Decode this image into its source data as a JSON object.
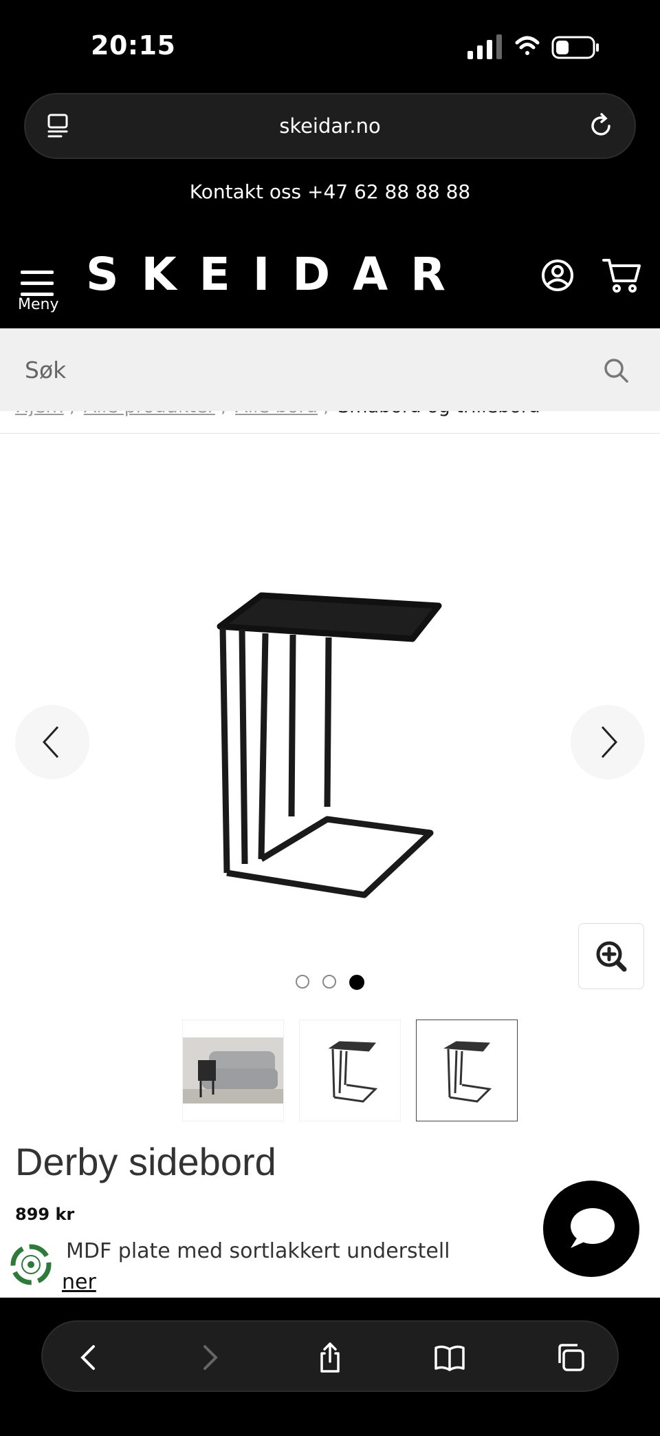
{
  "status_bar": {
    "time": "20:15"
  },
  "browser": {
    "url": "skeidar.no"
  },
  "site": {
    "contact": "Kontakt oss +47 62 88 88 88",
    "menu_label": "Meny",
    "logo": "SKEIDAR",
    "search_placeholder": "Søk"
  },
  "breadcrumb": {
    "items": [
      "Hjem",
      "Alle produkter",
      "Alle bord"
    ],
    "current": "Småbord og trillebord",
    "separator": "/"
  },
  "gallery": {
    "image_count": 3,
    "active_index": 2
  },
  "product": {
    "title": "Derby sidebord",
    "price": "899 kr",
    "description": "MDF plate med sortlakkert understell",
    "more_link": "ner"
  },
  "colors": {
    "top_bar": "#000000",
    "search_bg": "#f0f0f0",
    "chat": "#000000"
  }
}
